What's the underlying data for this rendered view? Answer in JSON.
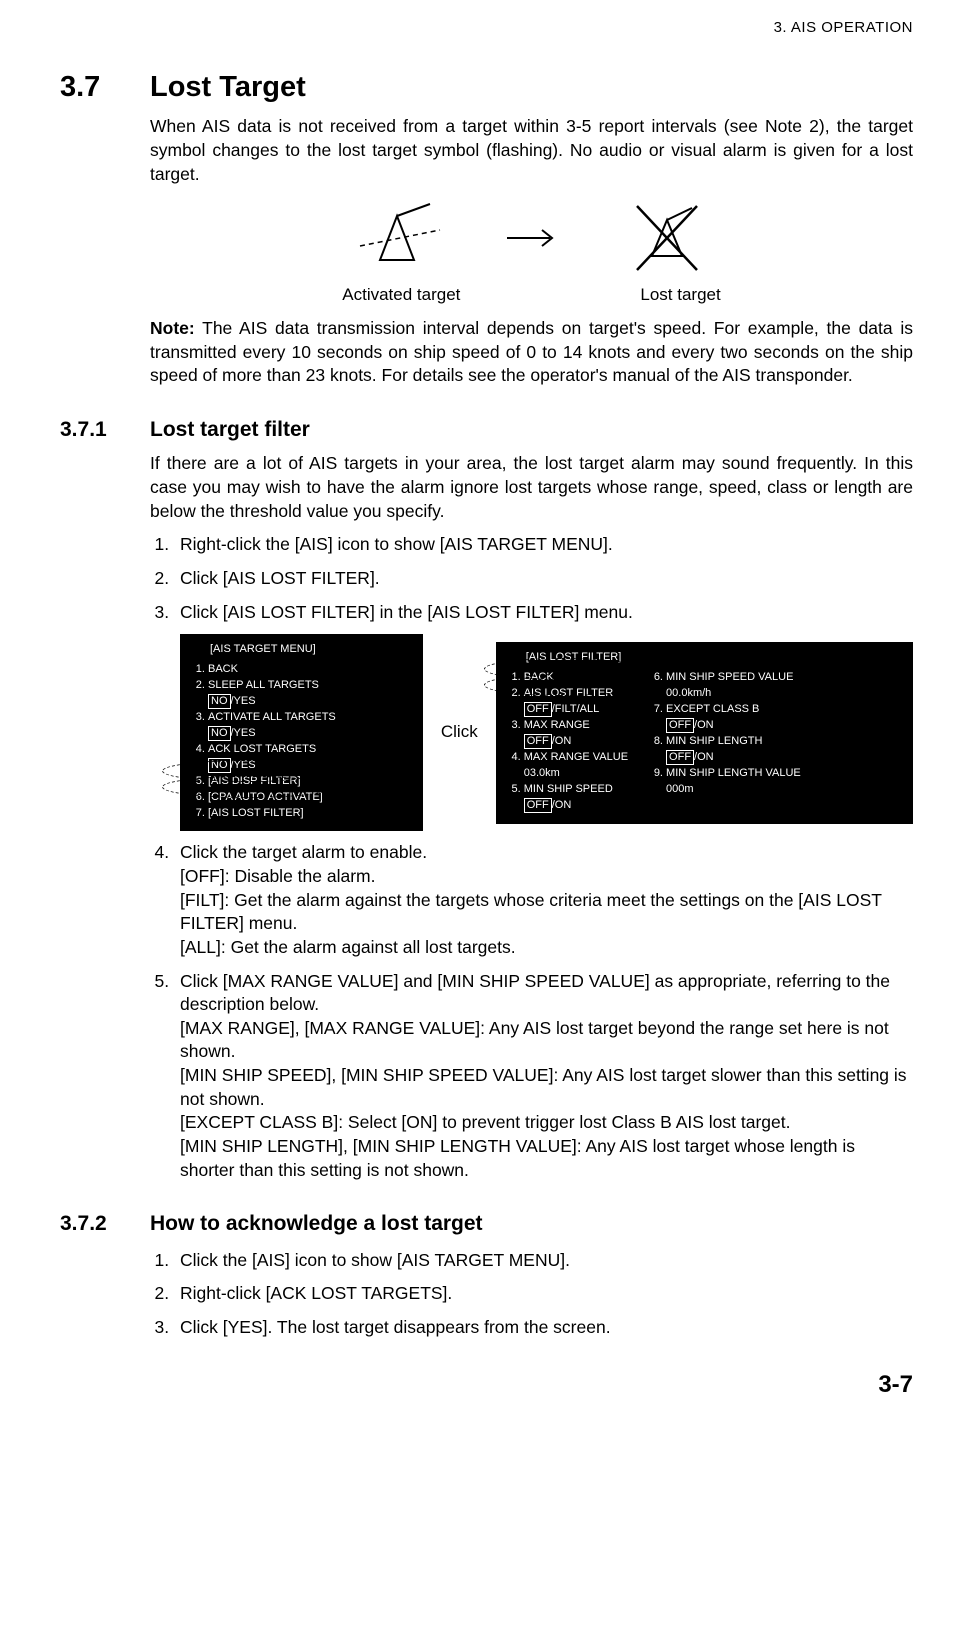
{
  "header": {
    "chapter": "3.  AIS OPERATION"
  },
  "s37": {
    "num": "3.7",
    "title": "Lost Target",
    "p1": "When AIS data is not received from a target within 3-5 report intervals (see Note 2), the target symbol changes to the lost target symbol (flashing). No audio or visual alarm is given for a lost target.",
    "cap1": "Activated target",
    "cap2": "Lost target",
    "noteLabel": "Note:",
    "noteText": " The AIS data transmission interval depends on target's speed. For example, the data is transmitted every 10 seconds on ship speed of 0 to 14 knots and every two seconds on the ship speed of more than 23 knots. For details see the operator's manual of the AIS transponder."
  },
  "s371": {
    "num": "3.7.1",
    "title": "Lost target filter",
    "p1": "If there are a lot of AIS targets in your area, the lost target alarm may sound frequently. In this case you may wish to have the alarm ignore lost targets whose range, speed, class or length are below the threshold value you specify.",
    "steps": {
      "s1": "Right-click the [AIS] icon to show [AIS TARGET MENU].",
      "s2": "Click [AIS LOST FILTER].",
      "s3": "Click [AIS LOST FILTER] in the [AIS LOST FILTER] menu.",
      "s4a": "Click the target alarm to enable.",
      "s4b": "[OFF]: Disable the alarm.",
      "s4c": "[FILT]: Get the alarm against the targets whose criteria meet the settings on the [AIS LOST FILTER] menu.",
      "s4d": "[ALL]: Get the alarm against all lost targets.",
      "s5a": "Click [MAX RANGE VALUE] and [MIN SHIP SPEED VALUE] as appropriate, referring to the description below.",
      "s5b": "[MAX RANGE], [MAX RANGE VALUE]: Any AIS lost target beyond the range set here is not shown.",
      "s5c": "[MIN SHIP SPEED], [MIN SHIP SPEED VALUE]: Any AIS lost target slower than this setting is not shown.",
      "s5d": "[EXCEPT CLASS B]: Select [ON] to prevent trigger lost Class B AIS lost target.",
      "s5e": "[MIN SHIP LENGTH], [MIN SHIP LENGTH VALUE]: Any AIS lost target whose length is shorter than this setting is not shown."
    },
    "clickLabel": "Click",
    "menuLeft": {
      "title": "[AIS TARGET MENU]",
      "i1": "BACK",
      "i2": "SLEEP ALL TARGETS",
      "i2b": "NO",
      "i2c": "/YES",
      "i3": "ACTIVATE ALL TARGETS",
      "i3b": "NO",
      "i3c": "/YES",
      "i4": "ACK LOST TARGETS",
      "i4b": "NO",
      "i4c": "/YES",
      "i5": "[AIS DISP FILTER]",
      "i6": "[CPA AUTO ACTIVATE]",
      "i7": "[AIS LOST FILTER]"
    },
    "menuRight": {
      "title": "[AIS LOST FILTER]",
      "l1": "BACK",
      "l2": "AIS LOST FILTER",
      "l2b": "OFF",
      "l2c": "/FILT/ALL",
      "l3": "MAX RANGE",
      "l3b": "OFF",
      "l3c": "/ON",
      "l4": "MAX RANGE VALUE",
      "l4v": "03.0km",
      "l5": "MIN SHIP SPEED",
      "l5b": "OFF",
      "l5c": "/ON",
      "r6": "MIN SHIP SPEED VALUE",
      "r6v": "00.0km/h",
      "r7": "EXCEPT CLASS B",
      "r7b": "OFF",
      "r7c": "/ON",
      "r8": "MIN SHIP LENGTH",
      "r8b": "OFF",
      "r8c": "/ON",
      "r9": "MIN SHIP LENGTH VALUE",
      "r9v": "000m"
    }
  },
  "s372": {
    "num": "3.7.2",
    "title": "How to acknowledge a lost target",
    "s1": "Click the [AIS] icon to show [AIS TARGET MENU].",
    "s2": "Right-click [ACK LOST TARGETS].",
    "s3": "Click [YES]. The lost target disappears from the screen."
  },
  "pageNum": "3-7"
}
